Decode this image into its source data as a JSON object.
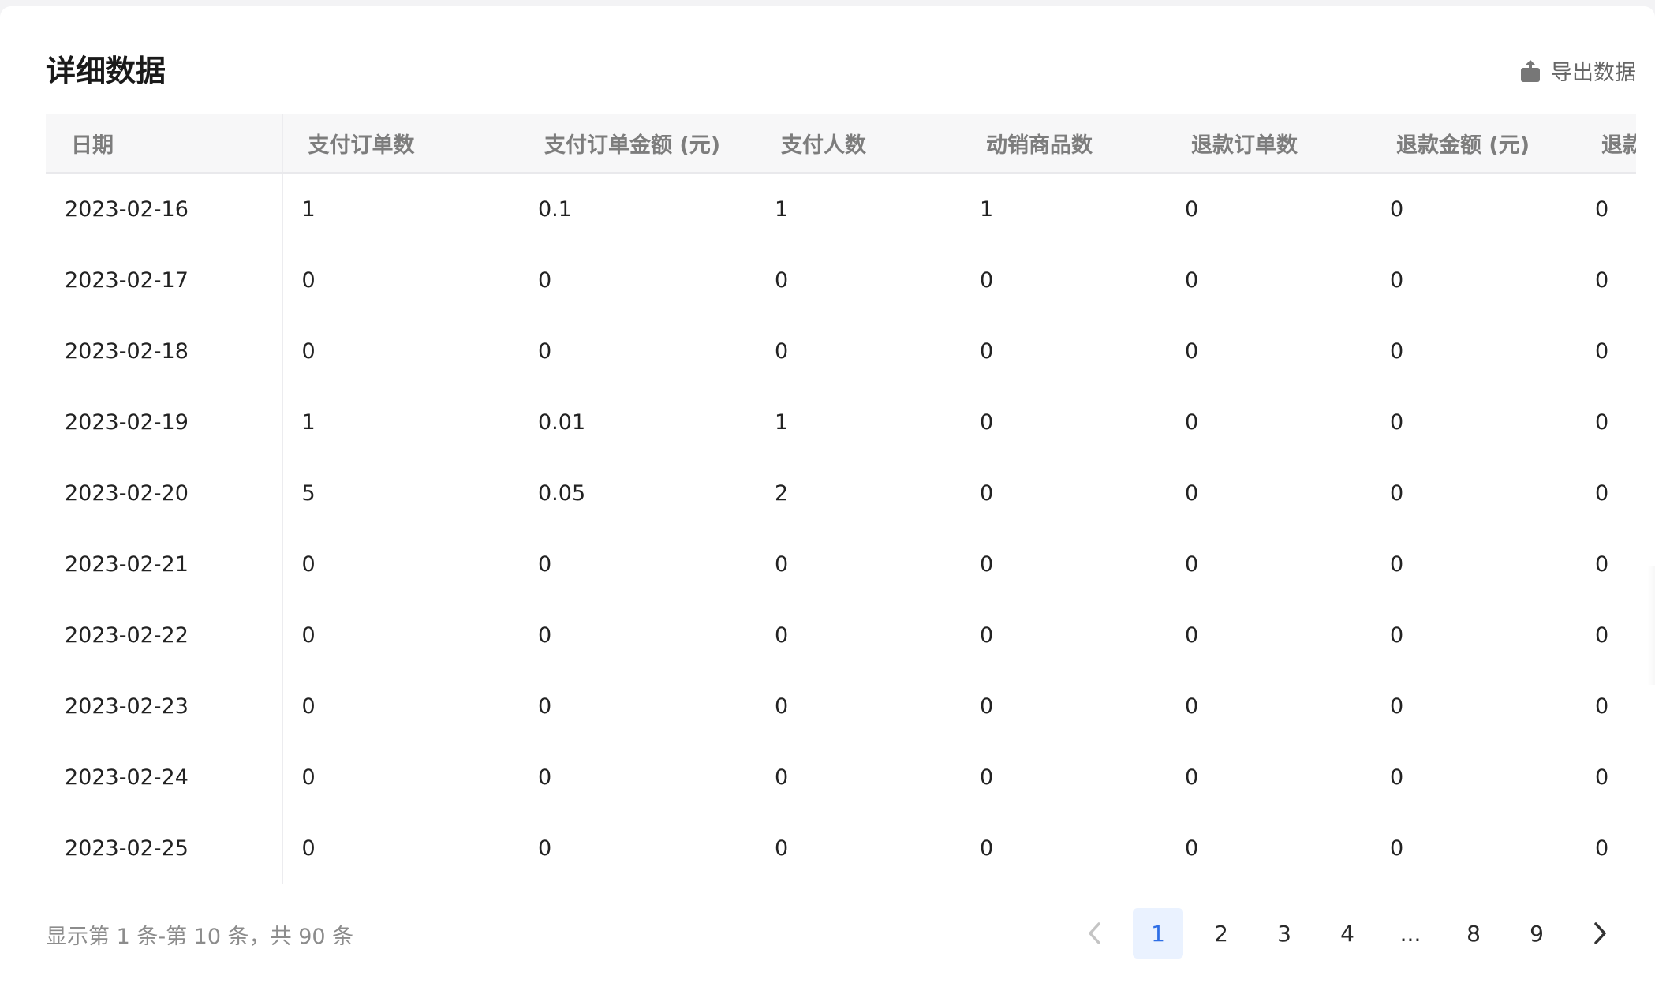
{
  "panel": {
    "title": "详细数据",
    "export_label": "导出数据"
  },
  "table": {
    "columns": [
      "日期",
      "支付订单数",
      "支付订单金额 (元)",
      "支付人数",
      "动销商品数",
      "退款订单数",
      "退款金额 (元)",
      "退款人"
    ],
    "rows": [
      [
        "2023-02-16",
        "1",
        "0.1",
        "1",
        "1",
        "0",
        "0",
        "0"
      ],
      [
        "2023-02-17",
        "0",
        "0",
        "0",
        "0",
        "0",
        "0",
        "0"
      ],
      [
        "2023-02-18",
        "0",
        "0",
        "0",
        "0",
        "0",
        "0",
        "0"
      ],
      [
        "2023-02-19",
        "1",
        "0.01",
        "1",
        "0",
        "0",
        "0",
        "0"
      ],
      [
        "2023-02-20",
        "5",
        "0.05",
        "2",
        "0",
        "0",
        "0",
        "0"
      ],
      [
        "2023-02-21",
        "0",
        "0",
        "0",
        "0",
        "0",
        "0",
        "0"
      ],
      [
        "2023-02-22",
        "0",
        "0",
        "0",
        "0",
        "0",
        "0",
        "0"
      ],
      [
        "2023-02-23",
        "0",
        "0",
        "0",
        "0",
        "0",
        "0",
        "0"
      ],
      [
        "2023-02-24",
        "0",
        "0",
        "0",
        "0",
        "0",
        "0",
        "0"
      ],
      [
        "2023-02-25",
        "0",
        "0",
        "0",
        "0",
        "0",
        "0",
        "0"
      ]
    ]
  },
  "pagination": {
    "summary": "显示第 1 条-第 10 条，共 90 条",
    "pages": [
      "1",
      "2",
      "3",
      "4",
      "...",
      "8",
      "9"
    ],
    "current": "1",
    "prev_icon": "chevron-left-icon",
    "next_icon": "chevron-right-icon"
  },
  "colors": {
    "accent": "#2f6fe6",
    "accent_bg": "#eaf2ff",
    "header_bg": "#f7f7f8",
    "muted_text": "#8c8c8c"
  }
}
